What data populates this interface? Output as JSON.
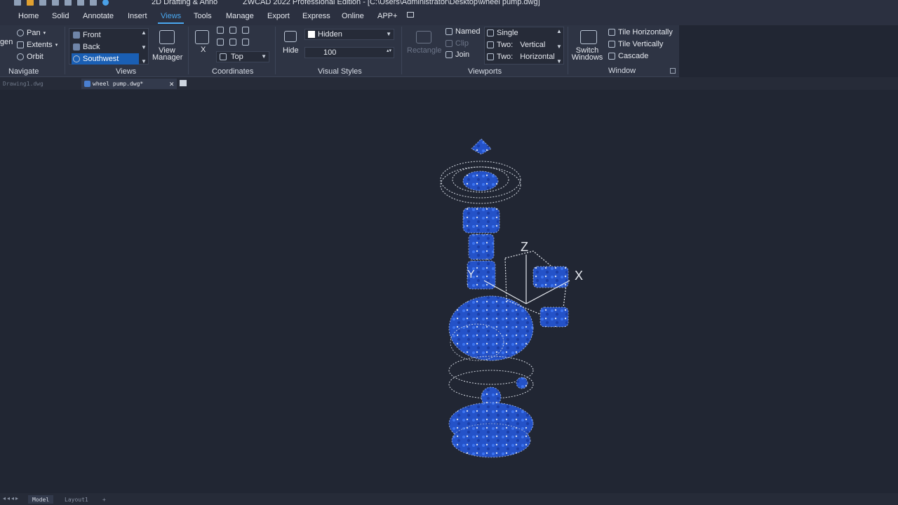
{
  "titlebar": {
    "workspace": "2D Drafting & Anno",
    "app_title": "ZWCAD 2022 Professional Edition - [C:\\Users\\Administrator\\Desktop\\wheel pump.dwg]"
  },
  "menu": {
    "tabs": [
      "Home",
      "Solid",
      "Annotate",
      "Insert",
      "Views",
      "Tools",
      "Manage",
      "Export",
      "Express",
      "Online",
      "APP+"
    ],
    "active": "Views"
  },
  "ribbon": {
    "navigate": {
      "label": "Navigate",
      "pan": "Pan",
      "extents": "Extents",
      "orbit": "Orbit",
      "cut": "gen"
    },
    "views": {
      "label": "Views",
      "items": [
        "Front",
        "Back",
        "Southwest"
      ],
      "selected": "Southwest",
      "view_manager_line1": "View",
      "view_manager_line2": "Manager"
    },
    "coordinates": {
      "label": "Coordinates",
      "x": "X",
      "top_option": "Top"
    },
    "visual_styles": {
      "label": "Visual Styles",
      "hide": "Hide",
      "style_value": "Hidden",
      "opacity_value": "100"
    },
    "viewports": {
      "label": "Viewports",
      "rectangle": "Rectangle",
      "named": "Named",
      "clip": "Clip",
      "join": "Join",
      "single": "Single",
      "two_vertical_a": "Two:",
      "two_vertical_b": "Vertical",
      "two_horizontal_a": "Two:",
      "two_horizontal_b": "Horizontal"
    },
    "window": {
      "label": "Window",
      "switch_line1": "Switch",
      "switch_line2": "Windows",
      "tile_h": "Tile Horizontally",
      "tile_v": "Tile Vertically",
      "cascade": "Cascade"
    }
  },
  "documents": {
    "inactive_tab": "Drawing1.dwg",
    "active_tab": "wheel pump.dwg*"
  },
  "viewport": {
    "axis_z": "Z",
    "axis_x": "X",
    "axis_y": "Y"
  },
  "layouts": {
    "tabs": [
      "Model",
      "Layout1"
    ],
    "add": "+"
  },
  "colors": {
    "accent": "#4aa8f0",
    "model_blue": "#2b5fe0",
    "background": "#212633"
  }
}
